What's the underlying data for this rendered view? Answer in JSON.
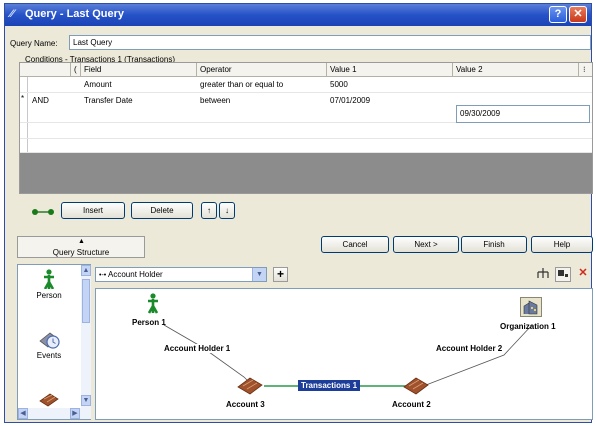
{
  "window": {
    "title": "Query - Last Query"
  },
  "query_name": {
    "label": "Query Name:",
    "value": "Last Query"
  },
  "conditions": {
    "label": "Conditions - Transactions 1 (Transactions)",
    "columns": [
      "(",
      "Field",
      "Operator",
      "Value 1",
      "Value 2"
    ],
    "rows": [
      {
        "marker": "",
        "logic": "",
        "paren": "",
        "field": "Amount",
        "operator": "greater than or equal to",
        "value1": "5000",
        "value2": ""
      },
      {
        "marker": "*",
        "logic": "AND",
        "paren": "",
        "field": "Transfer Date",
        "operator": "between",
        "value1": "07/01/2009",
        "value2": "09/30/2009"
      }
    ]
  },
  "row_buttons": {
    "insert": "Insert",
    "delete": "Delete",
    "up": "↑",
    "down": "↓"
  },
  "query_structure": {
    "arrow": "▲",
    "label": "Query Structure"
  },
  "nav_buttons": {
    "cancel": "Cancel",
    "next": "Next >",
    "finish": "Finish",
    "help": "Help"
  },
  "palette": {
    "items": [
      "Person",
      "Events"
    ]
  },
  "link_combo": {
    "value": "Account Holder"
  },
  "diagram": {
    "nodes": {
      "person": "Person 1",
      "organization": "Organization 1",
      "account3": "Account 3",
      "account2": "Account 2"
    },
    "edges": {
      "holder1": "Account Holder 1",
      "holder2": "Account Holder 2",
      "transactions": "Transactions 1"
    }
  },
  "colors": {
    "title_bar": "#2652c8",
    "selected_edge": "#1d3d9a",
    "person_icon": "#1a8a2a",
    "account_icon": "#a0522d"
  }
}
